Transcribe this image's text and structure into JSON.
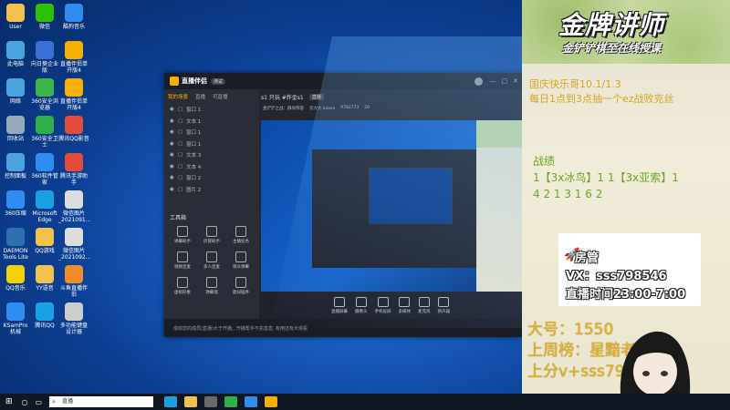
{
  "desktop_icons": [
    {
      "label": "User",
      "color": "#f2c14e"
    },
    {
      "label": "微信",
      "color": "#2dc100"
    },
    {
      "label": "酷狗音乐",
      "color": "#2f8cf0"
    },
    {
      "label": "此电脑",
      "color": "#4aa3df"
    },
    {
      "label": "向日葵企业版",
      "color": "#3a6fd8"
    },
    {
      "label": "直播伴侣单开版4",
      "color": "#f6b000"
    },
    {
      "label": "网络",
      "color": "#4aa3df"
    },
    {
      "label": "360安全浏览器",
      "color": "#39b54a"
    },
    {
      "label": "直播伴侣单开版4",
      "color": "#f6b000"
    },
    {
      "label": "回收站",
      "color": "#9ab"
    },
    {
      "label": "360安全卫士",
      "color": "#2fae49"
    },
    {
      "label": "腾讯QQ影音",
      "color": "#e34b3b"
    },
    {
      "label": "控制面板",
      "color": "#4aa3df"
    },
    {
      "label": "360软件管家",
      "color": "#2f8cf0"
    },
    {
      "label": "腾讯手游助手",
      "color": "#e34b3b"
    },
    {
      "label": "360压缩",
      "color": "#2f8cf0"
    },
    {
      "label": "Microsoft Edge",
      "color": "#1ba1e2"
    },
    {
      "label": "微信图片_2021091...",
      "color": "#ddd"
    },
    {
      "label": "DAEMON Tools Lite",
      "color": "#2f6fb0"
    },
    {
      "label": "QQ游戏",
      "color": "#f2c14e"
    },
    {
      "label": "微信图片_2021092...",
      "color": "#ddd"
    },
    {
      "label": "QQ音乐",
      "color": "#f2d200"
    },
    {
      "label": "YY语音",
      "color": "#f2c14e"
    },
    {
      "label": "斗鱼直播伴侣",
      "color": "#f28c28"
    },
    {
      "label": "KSamPro 机械",
      "color": "#2f8cf0"
    },
    {
      "label": "腾讯QQ",
      "color": "#1aa0e6"
    },
    {
      "label": "多功能键盘设计器",
      "color": "#ccc"
    }
  ],
  "taskbar": {
    "search_placeholder": "直播"
  },
  "app": {
    "logo": "直播伴侣",
    "version": "测试",
    "tabs": [
      "我的场景",
      "直播",
      "可直播"
    ],
    "scene_title": "s1 只玩 #炸金s1",
    "scene_badge": "直播",
    "status_chips": [
      "金铲铲之战：群攻阵容",
      "云大大.xxxxx",
      "9782773",
      "20"
    ],
    "layers": [
      "窗口 1",
      "文本 1",
      "窗口 1",
      "窗口 1",
      "文本 3",
      "文本 4",
      "窗口 2",
      "图片 2"
    ],
    "tools_title": "工具箱",
    "tools": [
      "弹幕助手",
      "房管助手",
      "主播任务",
      "视频连麦",
      "多人连麦",
      "观众弹幕",
      "虚拟形象",
      "弹幕墙",
      "歌词插件"
    ],
    "controls": [
      "直播屏幕",
      "摄像头",
      "手机投屏",
      "多媒体",
      "麦克风",
      "扬声器"
    ],
    "status_text": "成绩您的成员(直播)大于开播;, 开播帮手不完善直, 有用还有大观看"
  },
  "overlay": {
    "banner_title": "金牌讲师",
    "banner_subtitle": "金铲铲棋至在线授课",
    "notice_lines": [
      "国庆快乐哥10.1/1.3",
      "每日1点到3点抽一个ez战败克丝"
    ],
    "record_title": "战绩",
    "record_lines": [
      "1【3x冰鸟】1 1【3x亚索】1",
      "4 2 1 3 1 6 2"
    ],
    "card_lines": [
      "房管",
      "VX：sss798546",
      "直播时间23:00-7:00"
    ],
    "bottom_lines": [
      "大号：1550",
      "上周榜：星黯老板",
      "上分v+sss798546"
    ]
  }
}
